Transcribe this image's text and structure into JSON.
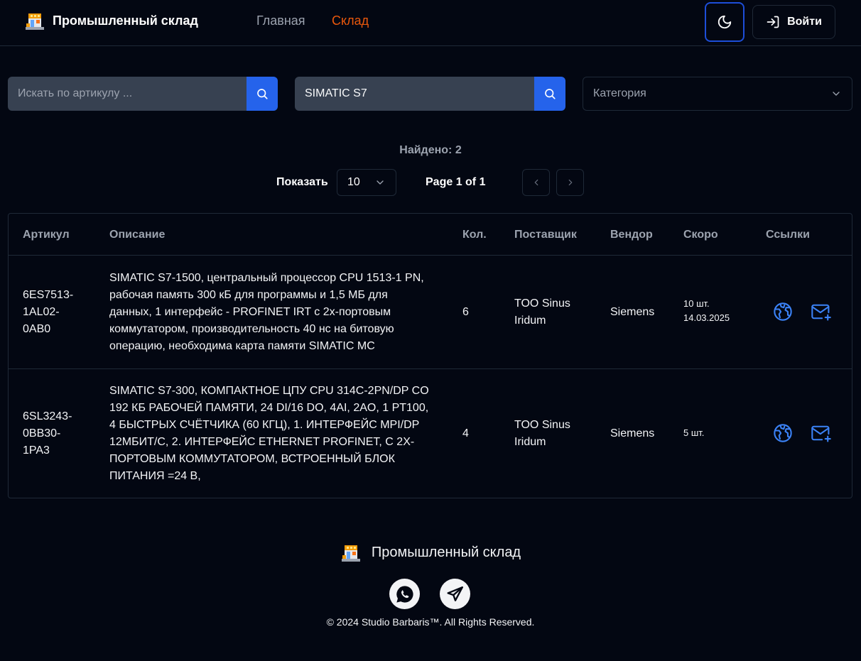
{
  "header": {
    "brand_name": "Промышленный склад",
    "nav": [
      {
        "label": "Главная",
        "active": false
      },
      {
        "label": "Склад",
        "active": true
      }
    ],
    "login_label": "Войти"
  },
  "filters": {
    "article_search": {
      "placeholder": "Искать по артикулу ...",
      "value": ""
    },
    "text_search": {
      "placeholder": "",
      "value": "SIMATIC S7"
    },
    "category": {
      "selected": "Категория"
    }
  },
  "results": {
    "found_text": "Найдено: 2",
    "show_label": "Показать",
    "page_size": "10",
    "page_info": "Page 1 of 1"
  },
  "table": {
    "columns": [
      "Артикул",
      "Описание",
      "Кол.",
      "Поставщик",
      "Вендор",
      "Скоро",
      "Ссылки"
    ],
    "rows": [
      {
        "article": [
          "6ES7513-",
          "1AL02-",
          "0AB0"
        ],
        "description": [
          "SIMATIC S7-1500, центральный процессор CPU 1513-1 PN,",
          "рабочая память 300 кБ для программы и 1,5 МБ для",
          "данных, 1 интерфейс - PROFINET IRT с 2х-портовым",
          "коммутатором, производительность 40 нс на битовую",
          "операцию, необходима карта памяти SIMATIC MC"
        ],
        "qty": "6",
        "supplier": [
          "TOO Sinus",
          "Iridum"
        ],
        "vendor": "Siemens",
        "soon": [
          "10 шт.",
          "14.03.2025"
        ]
      },
      {
        "article": [
          "6SL3243-",
          "0BB30-",
          "1PA3"
        ],
        "description": [
          "SIMATIC S7-300, КОМПАКТНОЕ ЦПУ CPU 314C-2PN/DP CO",
          "192 КБ РАБОЧЕЙ ПАМЯТИ, 24 DI/16 DO, 4AI, 2AO, 1 PT100,",
          "4 БЫСТРЫХ СЧЁТЧИКА (60 КГЦ), 1. ИНТЕРФЕЙС MPI/DP",
          "12МБИТ/С, 2. ИНТЕРФЕЙС ETHERNET PROFINET, С 2Х-",
          "ПОРТОВЫМ КОММУТАТОРОМ, ВСТРОЕННЫЙ БЛОК",
          "ПИТАНИЯ =24 В,"
        ],
        "qty": "4",
        "supplier": [
          "TOO Sinus",
          "Iridum"
        ],
        "vendor": "Siemens",
        "soon": [
          "5 шт."
        ]
      }
    ]
  },
  "footer": {
    "brand_name": "Промышленный склад",
    "copyright": "© 2024 Studio Barbaris™. All Rights Reserved."
  },
  "icons": {
    "logo": "warehouse-logo-icon",
    "theme": "moon-icon",
    "login": "log-in-icon",
    "search": "search-icon",
    "category": "chevron-down-icon",
    "prev": "chevron-left-icon",
    "next": "chevron-right-icon",
    "web": "globe-icon",
    "mail": "mail-plus-icon",
    "whatsapp": "whatsapp-icon",
    "telegram": "telegram-icon"
  },
  "colors": {
    "background": "#030712",
    "accent": "#2563eb",
    "active_nav": "#ea580c",
    "link_icons": "#3b82f6"
  }
}
